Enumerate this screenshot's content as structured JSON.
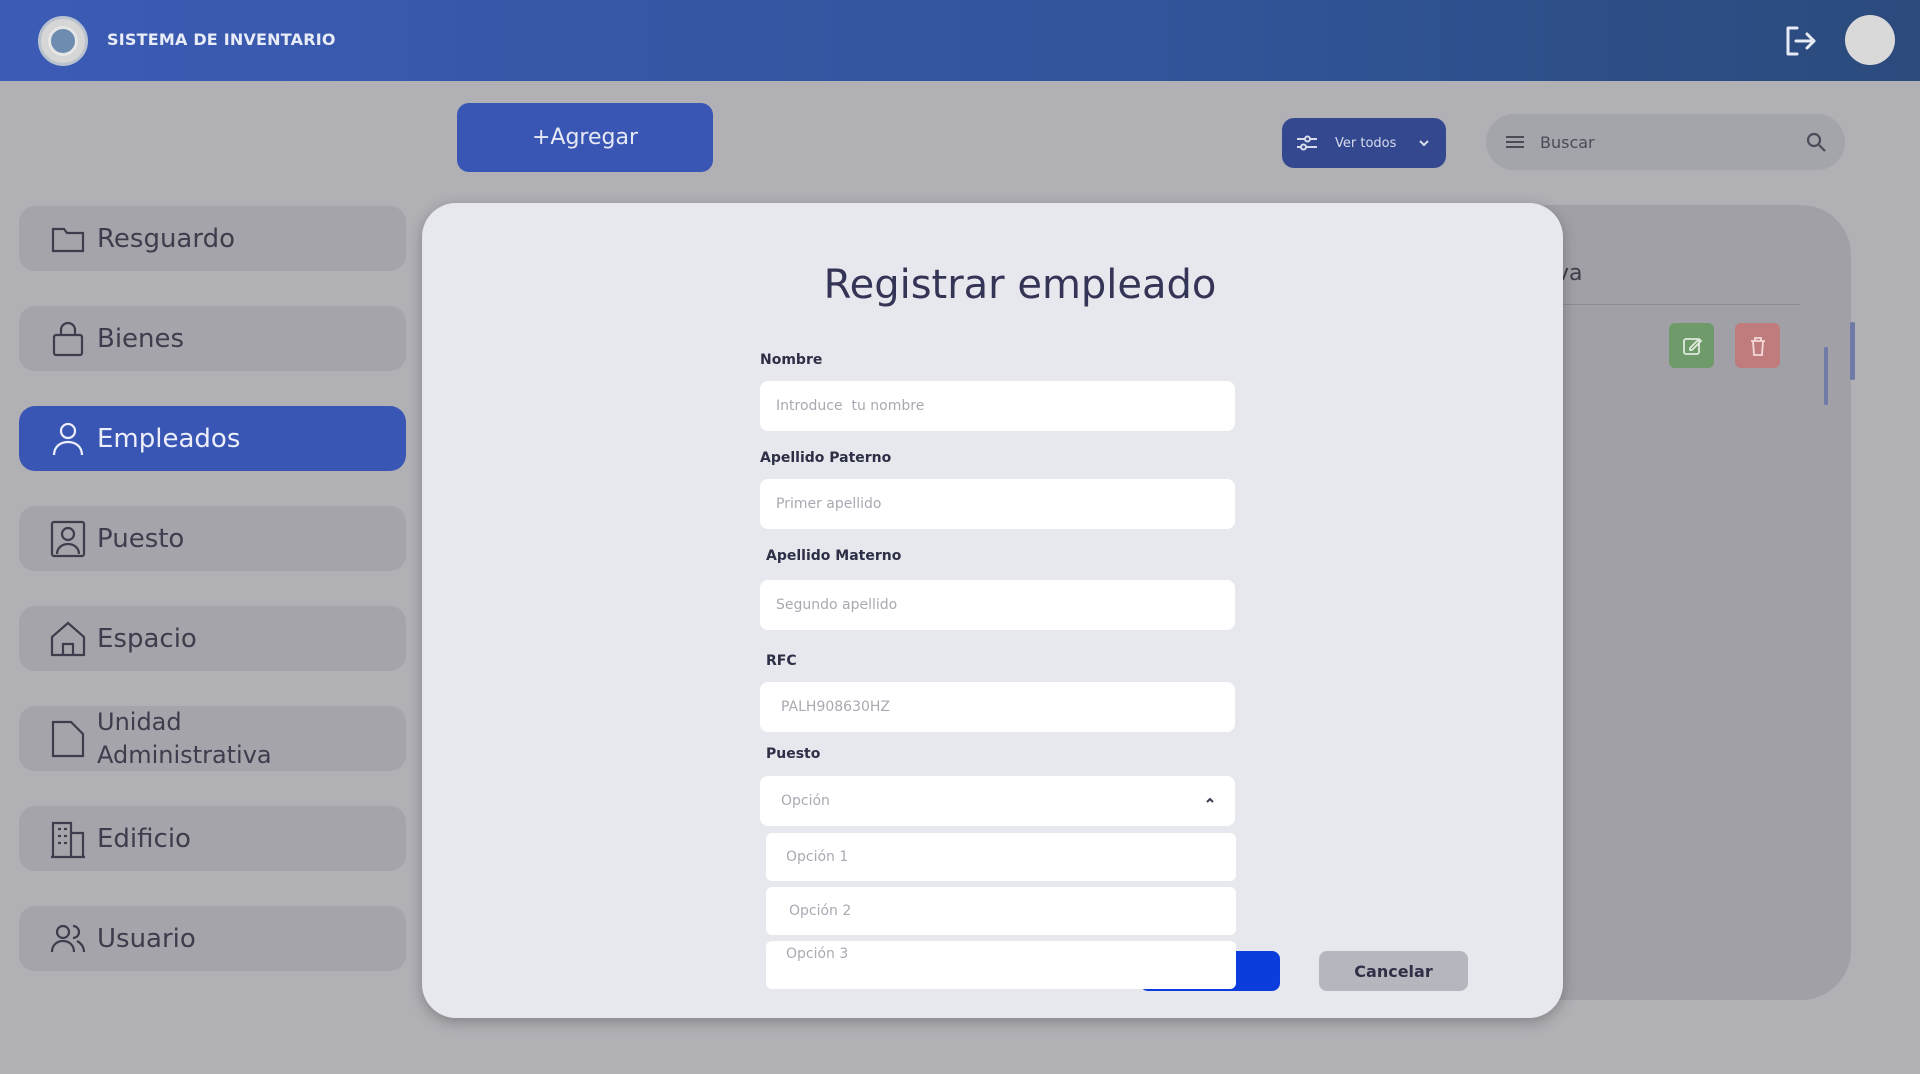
{
  "header": {
    "app_title": "SISTEMA DE INVENTARIO",
    "logout_icon": "logout-icon",
    "avatar_icon": "avatar"
  },
  "toolbar": {
    "add_label": "+Agregar",
    "filter_label": "Ver todos",
    "search_placeholder": "Buscar"
  },
  "sidebar": {
    "items": [
      {
        "label": "Resguardo",
        "icon": "folder-icon"
      },
      {
        "label": "Bienes",
        "icon": "bag-icon"
      },
      {
        "label": "Empleados",
        "icon": "user-icon",
        "active": true
      },
      {
        "label": "Puesto",
        "icon": "id-card-icon"
      },
      {
        "label": "Espacio",
        "icon": "home-icon"
      },
      {
        "label_line1": "Unidad",
        "label_line2": "Administrativa",
        "icon": "document-icon"
      },
      {
        "label": "Edificio",
        "icon": "building-icon"
      },
      {
        "label": "Usuario",
        "icon": "users-icon"
      }
    ]
  },
  "background_table": {
    "column_header_fragment": "va"
  },
  "modal": {
    "title": "Registrar empleado",
    "fields": {
      "nombre": {
        "label": "Nombre",
        "placeholder": "Introduce  tu nombre"
      },
      "apellido_paterno": {
        "label": "Apellido Paterno",
        "placeholder": "Primer apellido"
      },
      "apellido_materno": {
        "label": "Apellido Materno",
        "placeholder": "Segundo apellido"
      },
      "rfc": {
        "label": "RFC",
        "placeholder": "PALH908630HZ"
      },
      "puesto": {
        "label": "Puesto",
        "placeholder": "Opción",
        "options": [
          "Opción 1",
          "Opción 2",
          "Opción 3"
        ]
      }
    },
    "cancel_label": "Cancelar"
  },
  "colors": {
    "primary": "#3a56b4",
    "save": "#0a3ddb",
    "edit": "#6f9a6a",
    "delete": "#c07c7d"
  }
}
